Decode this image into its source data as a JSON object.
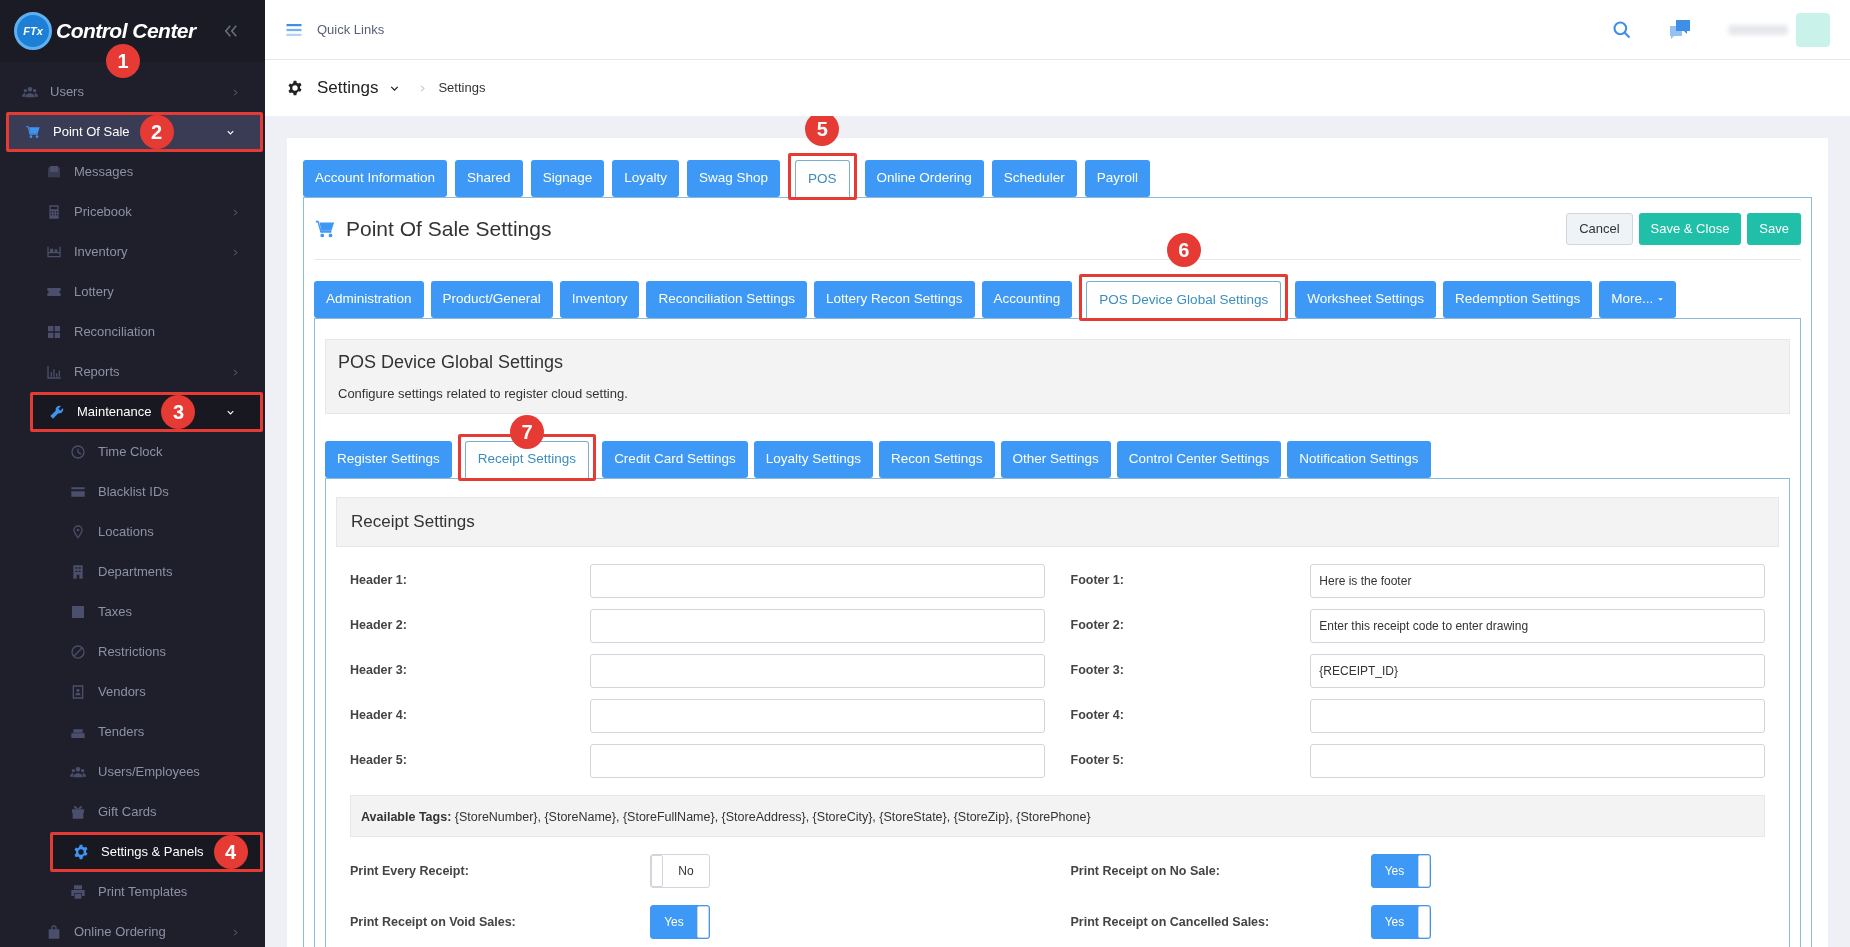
{
  "sidebar": {
    "logo": {
      "badge": "FTx",
      "text": "Control Center",
      "callout": "1"
    },
    "items": [
      {
        "label": "Users",
        "expandable": true,
        "expanded": false,
        "selected": false,
        "highlighted": false
      },
      {
        "label": "Point Of Sale",
        "expandable": true,
        "expanded": true,
        "selected": true,
        "highlighted": true,
        "callout": "2",
        "children": [
          {
            "label": "Messages",
            "expandable": false,
            "expanded": false,
            "selected": false,
            "highlighted": false
          },
          {
            "label": "Pricebook",
            "expandable": true,
            "expanded": false,
            "selected": false,
            "highlighted": false
          },
          {
            "label": "Inventory",
            "expandable": true,
            "expanded": false,
            "selected": false,
            "highlighted": false
          },
          {
            "label": "Lottery",
            "expandable": false,
            "expanded": false,
            "selected": false,
            "highlighted": false
          },
          {
            "label": "Reconciliation",
            "expandable": false,
            "expanded": false,
            "selected": false,
            "highlighted": false
          },
          {
            "label": "Reports",
            "expandable": true,
            "expanded": false,
            "selected": false,
            "highlighted": false
          },
          {
            "label": "Maintenance",
            "expandable": true,
            "expanded": true,
            "selected": true,
            "highlighted": true,
            "callout": "3",
            "children": [
              {
                "label": "Time Clock",
                "expandable": false,
                "expanded": false,
                "selected": false,
                "highlighted": false
              },
              {
                "label": "Blacklist IDs",
                "expandable": false,
                "expanded": false,
                "selected": false,
                "highlighted": false
              },
              {
                "label": "Locations",
                "expandable": false,
                "expanded": false,
                "selected": false,
                "highlighted": false
              },
              {
                "label": "Departments",
                "expandable": false,
                "expanded": false,
                "selected": false,
                "highlighted": false
              },
              {
                "label": "Taxes",
                "expandable": false,
                "expanded": false,
                "selected": false,
                "highlighted": false
              },
              {
                "label": "Restrictions",
                "expandable": false,
                "expanded": false,
                "selected": false,
                "highlighted": false
              },
              {
                "label": "Vendors",
                "expandable": false,
                "expanded": false,
                "selected": false,
                "highlighted": false
              },
              {
                "label": "Tenders",
                "expandable": false,
                "expanded": false,
                "selected": false,
                "highlighted": false
              },
              {
                "label": "Users/Employees",
                "expandable": false,
                "expanded": false,
                "selected": false,
                "highlighted": false
              },
              {
                "label": "Gift Cards",
                "expandable": false,
                "expanded": false,
                "selected": false,
                "highlighted": false
              },
              {
                "label": "Settings & Panels",
                "expandable": false,
                "expanded": false,
                "selected": true,
                "highlighted": true,
                "callout": "4"
              },
              {
                "label": "Print Templates",
                "expandable": false,
                "expanded": false,
                "selected": false,
                "highlighted": false
              }
            ]
          },
          {
            "label": "Online Ordering",
            "expandable": true,
            "expanded": false,
            "selected": false,
            "highlighted": false
          }
        ]
      }
    ]
  },
  "topbar": {
    "quick_links": "Quick Links"
  },
  "breadcrumb": {
    "title": "Settings",
    "current": "Settings"
  },
  "main_tabs": [
    {
      "label": "Account Information",
      "selected": false
    },
    {
      "label": "Shared",
      "selected": false
    },
    {
      "label": "Signage",
      "selected": false
    },
    {
      "label": "Loyalty",
      "selected": false
    },
    {
      "label": "Swag Shop",
      "selected": false
    },
    {
      "label": "POS",
      "selected": true,
      "highlighted": true,
      "callout": "5"
    },
    {
      "label": "Online Ordering",
      "selected": false
    },
    {
      "label": "Scheduler",
      "selected": false
    },
    {
      "label": "Payroll",
      "selected": false
    }
  ],
  "section": {
    "title": "Point Of Sale Settings",
    "buttons": [
      {
        "label": "Cancel",
        "kind": "secondary"
      },
      {
        "label": "Save & Close",
        "kind": "primary"
      },
      {
        "label": "Save",
        "kind": "primary"
      }
    ]
  },
  "sub_tabs": [
    {
      "label": "Administration",
      "selected": false,
      "dropdown": false
    },
    {
      "label": "Product/General",
      "selected": false,
      "dropdown": false
    },
    {
      "label": "Inventory",
      "selected": false,
      "dropdown": false
    },
    {
      "label": "Reconciliation Settings",
      "selected": false,
      "dropdown": false
    },
    {
      "label": "Lottery Recon Settings",
      "selected": false,
      "dropdown": false
    },
    {
      "label": "Accounting",
      "selected": false,
      "dropdown": false
    },
    {
      "label": "POS Device Global Settings",
      "selected": true,
      "highlighted": true,
      "callout": "6",
      "dropdown": false
    },
    {
      "label": "Worksheet Settings",
      "selected": false,
      "dropdown": false
    },
    {
      "label": "Redemption Settings",
      "selected": false,
      "dropdown": false
    },
    {
      "label": "More...",
      "selected": false,
      "dropdown": true
    }
  ],
  "device_panel": {
    "title": "POS Device Global Settings",
    "description": "Configure settings related to register cloud setting."
  },
  "device_tabs": [
    {
      "label": "Register Settings",
      "selected": false
    },
    {
      "label": "Receipt Settings",
      "selected": true,
      "highlighted": true,
      "callout": "7"
    },
    {
      "label": "Credit Card Settings",
      "selected": false
    },
    {
      "label": "Loyalty Settings",
      "selected": false
    },
    {
      "label": "Recon Settings",
      "selected": false
    },
    {
      "label": "Other Settings",
      "selected": false
    },
    {
      "label": "Control Center Settings",
      "selected": false
    },
    {
      "label": "Notification Settings",
      "selected": false
    }
  ],
  "receipt": {
    "title": "Receipt Settings",
    "rows": [
      [
        {
          "label": "Header 1:"
        },
        {
          "label": "Footer 1:",
          "value": "Here is the footer"
        }
      ],
      [
        {
          "label": "Header 2:"
        },
        {
          "label": "Footer 2:",
          "value": "Enter this receipt code to enter drawing"
        }
      ],
      [
        {
          "label": "Header 3:"
        },
        {
          "label": "Footer 3:",
          "value": "{RECEIPT_ID}"
        }
      ],
      [
        {
          "label": "Header 4:"
        },
        {
          "label": "Footer 4:"
        }
      ],
      [
        {
          "label": "Header 5:"
        },
        {
          "label": "Footer 5:"
        }
      ]
    ],
    "tags": "**Available Tags:** {StoreNumber}, {StoreName}, {StoreFullName}, {StoreAddress}, {StoreCity}, {StoreState}, {StoreZip}, {StorePhone}",
    "toggles": [
      [
        {
          "label": "Print Every Receipt:",
          "on": false,
          "text": "No"
        },
        {
          "label": "Print Receipt on No Sale:",
          "on": true,
          "text": "Yes"
        }
      ],
      [
        {
          "label": "Print Receipt on Void Sales:",
          "on": true,
          "text": "Yes"
        },
        {
          "label": "Print Receipt on Cancelled Sales:",
          "on": true,
          "text": "Yes"
        }
      ]
    ]
  }
}
